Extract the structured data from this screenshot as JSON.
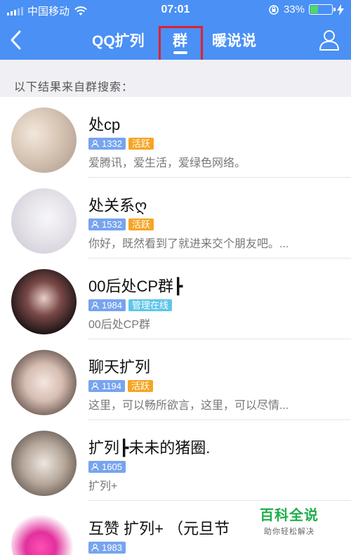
{
  "status_bar": {
    "carrier": "中国移动",
    "time": "07:01",
    "battery_percent": "33%",
    "battery_level": 0.33
  },
  "nav": {
    "tabs": [
      {
        "label": "QQ扩列"
      },
      {
        "label": "群"
      },
      {
        "label": "暖说说"
      }
    ],
    "active_tab": "群",
    "highlight_color": "#e3202a",
    "bar_color": "#4a90f5"
  },
  "subheader": {
    "text": "以下结果来自群搜索："
  },
  "results": [
    {
      "title": "处cp",
      "count": "1332",
      "badge": "活跃",
      "badge_type": "active",
      "desc": "爱腾讯，爱生活，爱绿色网络。"
    },
    {
      "title": "处关系ღ",
      "count": "1532",
      "badge": "活跃",
      "badge_type": "active",
      "desc": "你好，既然看到了就进来交个朋友吧。..."
    },
    {
      "title": "00后处CP群┣",
      "count": "1984",
      "badge": "管理在线",
      "badge_type": "admin",
      "desc": "00后处CP群"
    },
    {
      "title": "聊天扩列",
      "count": "1194",
      "badge": "活跃",
      "badge_type": "active",
      "desc": "这里，可以畅所欲言，这里，可以尽情..."
    },
    {
      "title": "扩列┣未未的猪圈.",
      "count": "1605",
      "badge": "",
      "badge_type": "none",
      "desc": "扩列+"
    },
    {
      "title": "互赞 扩列+ （元旦节",
      "count": "1983",
      "badge": "",
      "badge_type": "none",
      "desc": ""
    }
  ],
  "watermark": {
    "main": "百科全说",
    "sub": "助你轻松解决"
  }
}
